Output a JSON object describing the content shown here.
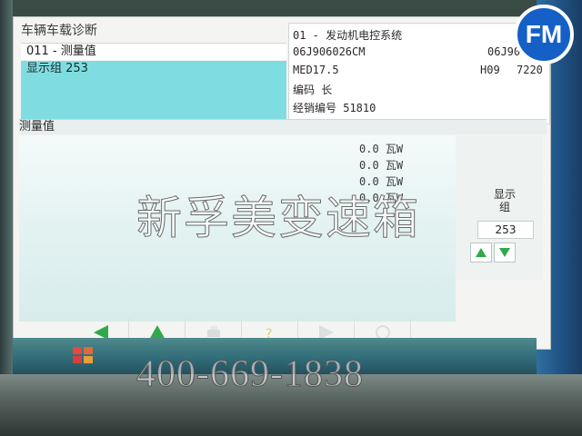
{
  "header": {
    "title": "车辆车载诊断"
  },
  "left_menu": {
    "item1": "011 - 测量值",
    "item2": "显示组 253"
  },
  "ecu_info": {
    "system": "01 - 发动机电控系统",
    "part_no": "06J906026CM",
    "part_no_right": "06J90602",
    "engine": "MED17.5",
    "code_right_1": "H09",
    "code_right_2": "7220",
    "code_line": "编码 长",
    "dealer_line": "经销编号 51810"
  },
  "measurements": {
    "header": "测量值",
    "rows": [
      "0.0 瓦W",
      "0.0 瓦W",
      "0.0 瓦W",
      "0.0 瓦W"
    ]
  },
  "display_group": {
    "label_line1": "显示",
    "label_line2": "组",
    "value": "253"
  },
  "watermarks": {
    "company": "新孚美变速箱",
    "phone": "400-669-1838",
    "logo": "FM"
  },
  "colors": {
    "selected_bg": "#7fdde2",
    "arrow_green": "#2faa4a",
    "logo_blue": "#1560c7"
  },
  "icons": {
    "back": "arrow-left-icon",
    "up": "triangle-up-icon",
    "print": "printer-icon",
    "help": "help-icon",
    "forward": "arrow-right-icon",
    "home": "home-icon"
  }
}
